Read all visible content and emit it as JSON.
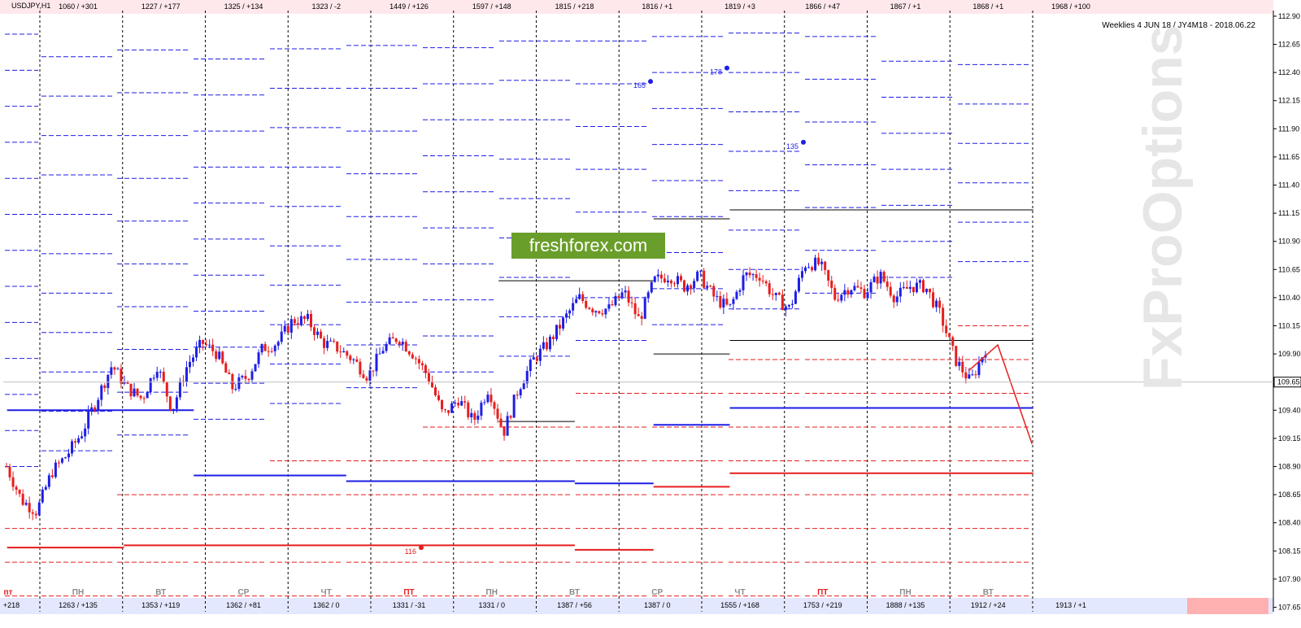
{
  "symbol": "USDJPY,H1",
  "logo_text": "freshforex.com",
  "weekly_text": "Weeklies 4 JUN 18 / JY4M18 - 2018.06.22",
  "watermark": "FxProOptions",
  "colors": {
    "bull": "#1e1ee6",
    "bear": "#e61e1e",
    "grid": "#000000",
    "blue_level": "#1e1ee6",
    "red_level": "#e61e1e",
    "top_band": "#ffe8ec",
    "bottom_band": "#e4e8ff",
    "logo_bg": "#6a9e2a"
  },
  "chart_data": {
    "type": "candlestick",
    "ylim": [
      107.61,
      112.95
    ],
    "yticks": [
      "112.90",
      "112.65",
      "112.40",
      "112.15",
      "111.90",
      "111.65",
      "111.40",
      "111.15",
      "110.90",
      "110.65",
      "110.40",
      "110.15",
      "109.90",
      "109.65",
      "109.40",
      "109.15",
      "108.90",
      "108.65",
      "108.40",
      "108.15",
      "107.90",
      "107.65"
    ],
    "current_price": "109.65",
    "top_labels": [
      "1060 / +301",
      "1227 / +177",
      "1325 / +134",
      "1323 / -2",
      "1449 / +126",
      "1597 / +148",
      "1815 / +218",
      "1816 / +1",
      "1819 / +3",
      "1866 / +47",
      "1867 / +1",
      "1868 / +1",
      "1968 / +100"
    ],
    "bottom_labels": [
      "+218",
      "1263 / +135",
      "1353 / +119",
      "1362 / +81",
      "1362 / 0",
      "1331 / -31",
      "1331 / 0",
      "1387 / +56",
      "1387 / 0",
      "1555 / +168",
      "1753 / +219",
      "1888 / +135",
      "1912 / +24",
      "1913 / +1"
    ],
    "day_labels": [
      "пт",
      "ПН",
      "ВТ",
      "СР",
      "ЧТ",
      "ПТ",
      "ПН",
      "ВТ",
      "СР",
      "ЧТ",
      "ПТ",
      "ПН",
      "ВТ"
    ],
    "markers": [
      {
        "label": "165",
        "price": 112.32
      },
      {
        "label": "178",
        "price": 112.44
      },
      {
        "label": "135",
        "price": 111.78
      },
      {
        "label": "116",
        "price": 108.18
      }
    ],
    "path": [
      [
        108.9,
        108.8
      ],
      [
        108.6,
        108.3
      ],
      [
        108.5,
        108.8
      ],
      [
        108.85,
        108.7
      ],
      [
        109.0,
        109.3
      ],
      [
        109.2,
        109.1
      ],
      [
        109.5,
        109.7
      ],
      [
        109.8,
        109.4
      ],
      [
        109.6,
        109.7
      ],
      [
        109.5,
        109.6
      ],
      [
        109.8,
        109.7
      ],
      [
        109.4,
        109.6
      ],
      [
        109.8,
        109.95
      ],
      [
        110.0,
        109.8
      ],
      [
        109.9,
        109.7
      ],
      [
        109.6,
        109.5
      ],
      [
        109.7,
        109.85
      ],
      [
        109.95,
        109.85
      ],
      [
        110.0,
        110.15
      ],
      [
        110.2,
        110.05
      ],
      [
        110.2,
        109.95
      ],
      [
        110.0,
        110.1
      ],
      [
        109.95,
        109.9
      ],
      [
        109.85,
        109.7
      ],
      [
        109.7,
        109.85
      ],
      [
        109.95,
        110.0
      ],
      [
        110.05,
        110.0
      ],
      [
        109.9,
        109.8
      ],
      [
        109.7,
        109.4
      ],
      [
        109.35,
        109.3
      ],
      [
        109.5,
        109.4
      ],
      [
        109.3,
        109.55
      ],
      [
        109.6,
        109.45
      ],
      [
        109.2,
        109.4
      ],
      [
        109.6,
        109.8
      ],
      [
        109.85,
        109.9
      ],
      [
        110.0,
        110.1
      ],
      [
        110.2,
        110.35
      ],
      [
        110.4,
        110.3
      ],
      [
        110.3,
        110.2
      ],
      [
        110.3,
        110.4
      ],
      [
        110.45,
        110.35
      ],
      [
        110.2,
        110.45
      ],
      [
        110.55,
        110.65
      ],
      [
        110.6,
        110.55
      ],
      [
        110.5,
        110.45
      ],
      [
        110.6,
        110.55
      ],
      [
        110.4,
        110.3
      ],
      [
        110.3,
        110.4
      ],
      [
        110.6,
        110.65
      ],
      [
        110.6,
        110.5
      ],
      [
        110.4,
        110.15
      ],
      [
        110.3,
        110.4
      ],
      [
        110.7,
        110.85
      ],
      [
        110.7,
        110.5
      ],
      [
        110.4,
        110.6
      ],
      [
        110.5,
        110.4
      ],
      [
        110.45,
        110.65
      ],
      [
        110.6,
        110.5
      ],
      [
        110.4,
        110.55
      ],
      [
        110.5,
        110.6
      ],
      [
        110.5,
        110.4
      ],
      [
        110.25,
        110.0
      ],
      [
        109.85,
        109.75
      ],
      [
        109.65,
        109.75
      ],
      [
        109.95,
        109.85
      ]
    ],
    "blue_levels": [
      {
        "price": 109.4,
        "x1": 0.003,
        "x2": 0.095,
        "w": 2
      },
      {
        "price": 109.4,
        "x1": 0.095,
        "x2": 0.15,
        "w": 2
      },
      {
        "price": 108.82,
        "x1": 0.15,
        "x2": 0.27,
        "w": 2
      },
      {
        "price": 108.77,
        "x1": 0.27,
        "x2": 0.45,
        "w": 2
      },
      {
        "price": 108.75,
        "x1": 0.45,
        "x2": 0.512,
        "w": 2
      },
      {
        "price": 109.27,
        "x1": 0.512,
        "x2": 0.572,
        "w": 2
      },
      {
        "price": 109.42,
        "x1": 0.572,
        "x2": 0.811,
        "w": 2
      }
    ],
    "red_levels": [
      {
        "price": 108.18,
        "x1": 0.003,
        "x2": 0.095,
        "w": 2
      },
      {
        "price": 108.2,
        "x1": 0.095,
        "x2": 0.45,
        "w": 2
      },
      {
        "price": 108.16,
        "x1": 0.45,
        "x2": 0.512,
        "w": 2
      },
      {
        "price": 108.72,
        "x1": 0.512,
        "x2": 0.572,
        "w": 2
      },
      {
        "price": 108.84,
        "x1": 0.572,
        "x2": 0.811,
        "w": 2
      }
    ],
    "black_levels": [
      {
        "price": 110.55,
        "x1": 0.39,
        "x2": 0.512
      },
      {
        "price": 111.1,
        "x1": 0.512,
        "x2": 0.572
      },
      {
        "price": 111.18,
        "x1": 0.572,
        "x2": 0.811
      },
      {
        "price": 110.02,
        "x1": 0.572,
        "x2": 0.811
      },
      {
        "price": 109.3,
        "x1": 0.39,
        "x2": 0.45
      },
      {
        "price": 109.9,
        "x1": 0.512,
        "x2": 0.572
      }
    ],
    "projection": [
      [
        0.76,
        109.75
      ],
      [
        0.783,
        109.98
      ],
      [
        0.81,
        109.1
      ]
    ]
  }
}
